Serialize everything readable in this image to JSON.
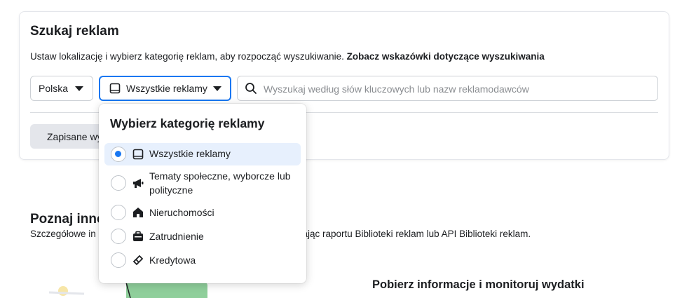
{
  "search_panel": {
    "title": "Szukaj reklam",
    "description": "Ustaw lokalizację i wybierz kategorię reklam, aby rozpocząć wyszukiwanie. ",
    "tips_link": "Zobacz wskazówki dotyczące wyszukiwania",
    "country_value": "Polska",
    "category_value": "Wszystkie reklamy",
    "search_placeholder": "Wyszukaj według słów kluczowych lub nazw reklamodawców",
    "saved_label": "Zapisane wyszukiwania"
  },
  "dropdown": {
    "title": "Wybierz kategorię reklamy",
    "options": [
      {
        "label": "Wszystkie reklamy",
        "icon": "tablet-icon",
        "selected": true
      },
      {
        "label": "Tematy społeczne, wyborcze lub",
        "label2": "polityczne",
        "icon": "megaphone-icon",
        "selected": false
      },
      {
        "label": "Nieruchomości",
        "icon": "house-icon",
        "selected": false
      },
      {
        "label": "Zatrudnienie",
        "icon": "briefcase-icon",
        "selected": false
      },
      {
        "label": "Kredytowa",
        "icon": "credit-icon",
        "selected": false
      }
    ]
  },
  "explore": {
    "title": "Poznaj inne",
    "desc_head": "Szczegółowe in",
    "desc_tail": "rając raportu Biblioteki reklam lub API Biblioteki reklam.",
    "spend_title": "Pobierz informacje i monitoruj wydatki"
  },
  "colors": {
    "accent": "#1877f2",
    "selected_bg": "#e7f0fd",
    "border": "#ccd0d5"
  }
}
